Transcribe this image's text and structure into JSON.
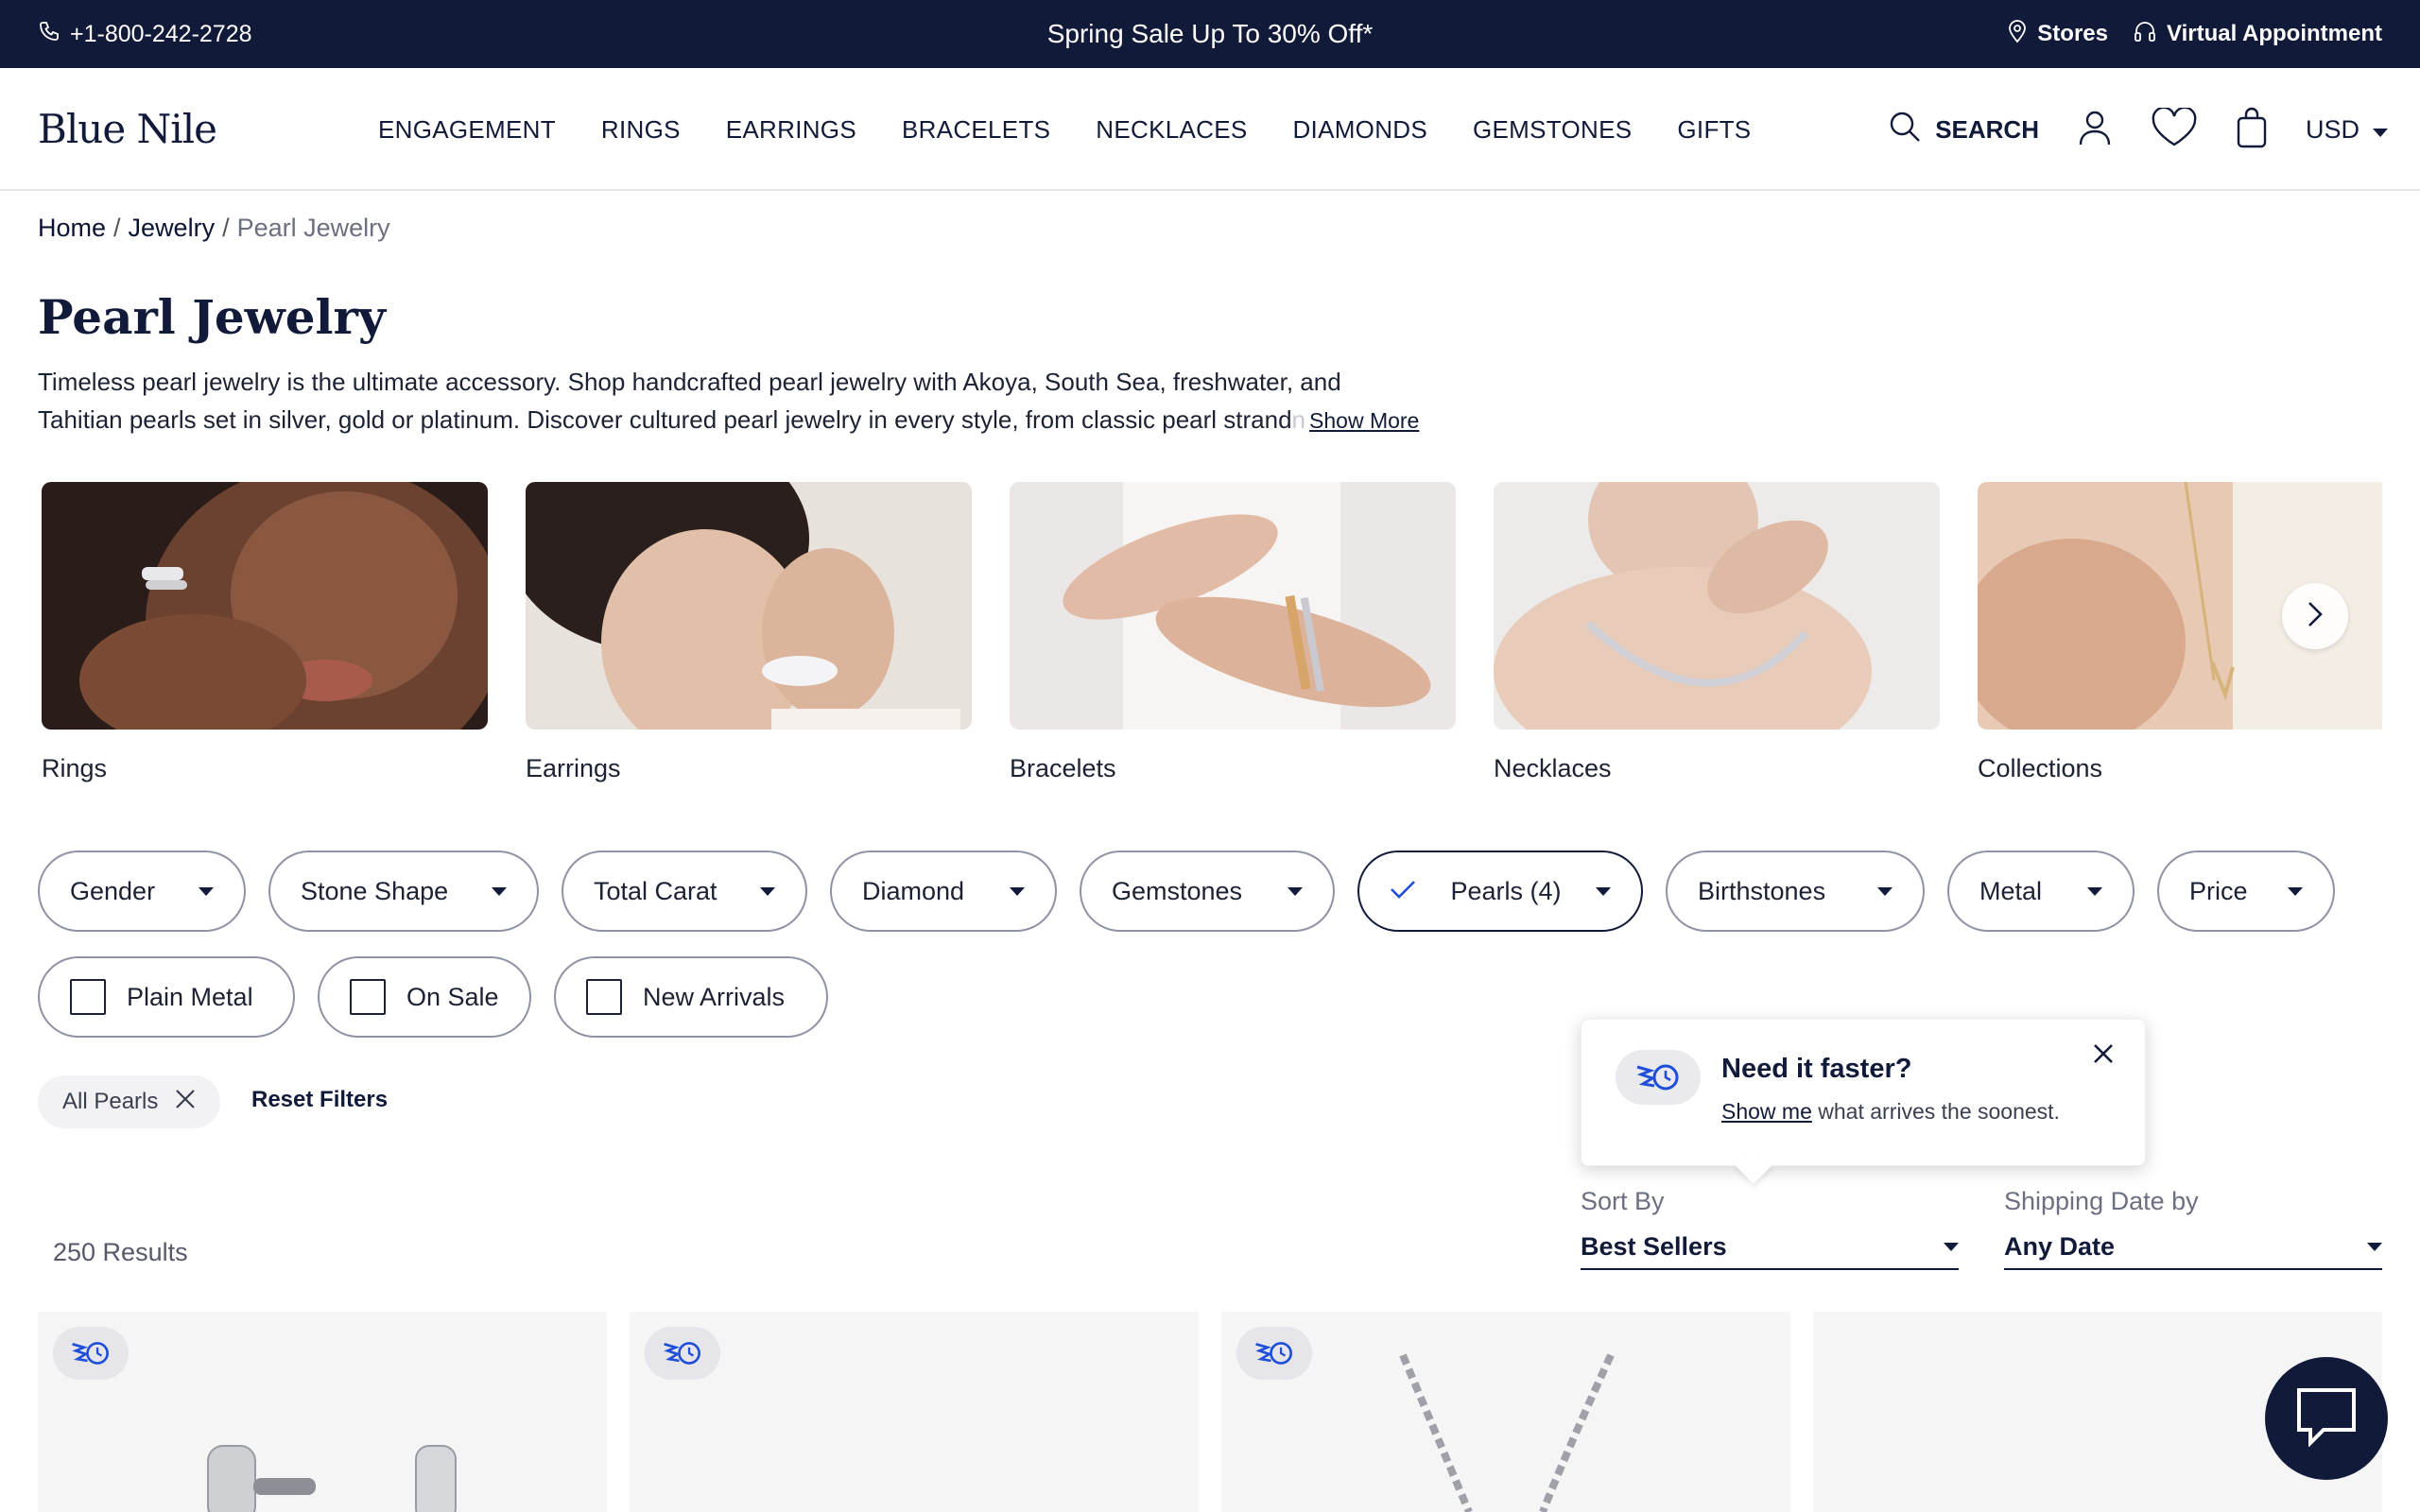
{
  "topbar": {
    "phone": "+1-800-242-2728",
    "promo": "Spring Sale Up To 30% Off*",
    "stores": "Stores",
    "virtual": "Virtual Appointment"
  },
  "header": {
    "logo": "Blue Nile",
    "nav": [
      "ENGAGEMENT",
      "RINGS",
      "EARRINGS",
      "BRACELETS",
      "NECKLACES",
      "DIAMONDS",
      "GEMSTONES",
      "GIFTS"
    ],
    "search_label": "SEARCH",
    "currency": "USD"
  },
  "breadcrumb": {
    "home": "Home",
    "jewelry": "Jewelry",
    "current": "Pearl Jewelry",
    "sep": "/"
  },
  "page": {
    "title": "Pearl Jewelry",
    "desc_line1": "Timeless pearl jewelry is the ultimate accessory. Shop handcrafted pearl jewelry with Akoya, South Sea, freshwater, and",
    "desc_line2": "Tahitian pearls set in silver, gold or platinum. Discover cultured pearl jewelry in every style, from classic pearl strand",
    "desc_fade": "n",
    "show_more": "Show More"
  },
  "categories": [
    {
      "label": "Rings"
    },
    {
      "label": "Earrings"
    },
    {
      "label": "Bracelets"
    },
    {
      "label": "Necklaces"
    },
    {
      "label": "Collections"
    }
  ],
  "filters": {
    "gender": "Gender",
    "stone_shape": "Stone Shape",
    "total_carat": "Total Carat",
    "diamond": "Diamond",
    "gemstones": "Gemstones",
    "pearls": "Pearls (4)",
    "birthstones": "Birthstones",
    "metal": "Metal",
    "price": "Price",
    "plain_metal": "Plain Metal",
    "on_sale": "On Sale",
    "new_arrivals": "New Arrivals",
    "applied_tag": "All Pearls",
    "reset": "Reset Filters"
  },
  "popover": {
    "title": "Need it faster?",
    "link": "Show me",
    "rest": " what arrives the soonest."
  },
  "sort": {
    "sort_label": "Sort By",
    "sort_value": "Best Sellers",
    "ship_label": "Shipping Date by",
    "ship_value": "Any Date"
  },
  "results": "250 Results",
  "colors": {
    "navy": "#121a3a",
    "accent_blue": "#1f4fd8"
  }
}
